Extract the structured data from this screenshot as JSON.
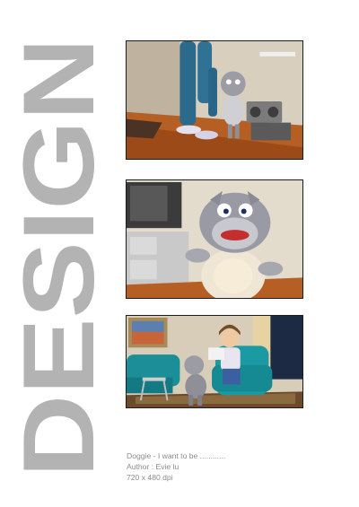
{
  "side_title": "DESIGN",
  "caption": {
    "title": "Doggie - I want to be ............",
    "author": "Author : Evie lu",
    "resolution": "720 x 480 dpi"
  },
  "colors": {
    "side_title": "#b3b3b3",
    "caption_text": "#8c8c8c",
    "background": "#ffffff"
  },
  "frames": [
    {
      "name": "frame-scene-1"
    },
    {
      "name": "frame-scene-2"
    },
    {
      "name": "frame-scene-3"
    }
  ]
}
